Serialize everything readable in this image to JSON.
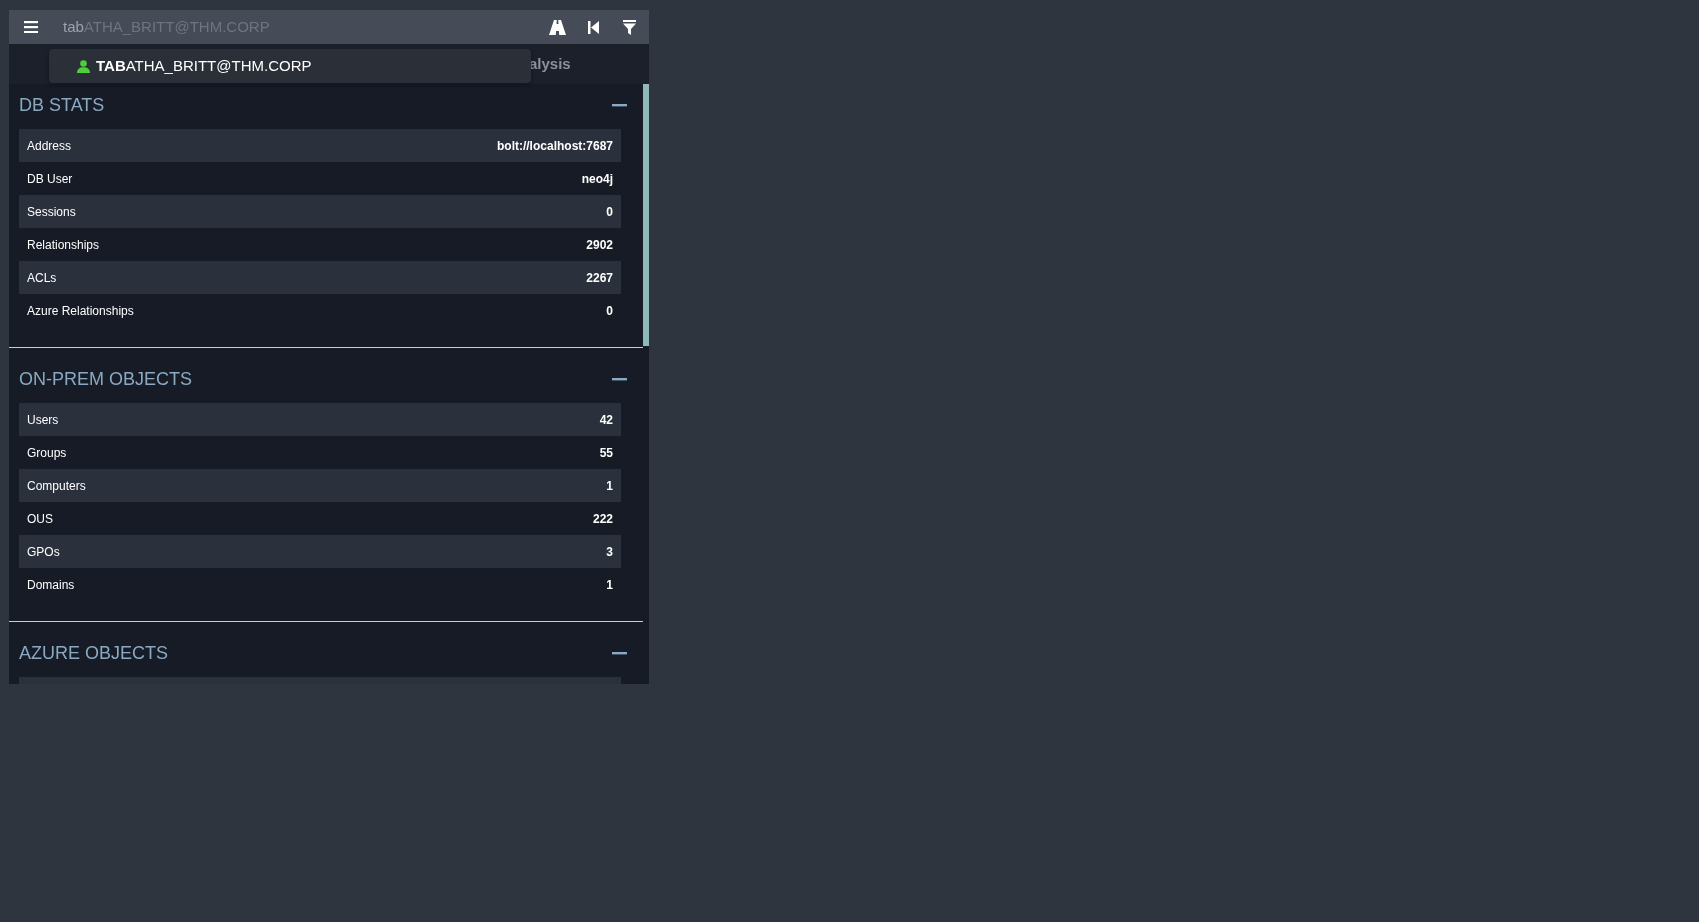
{
  "search": {
    "value": "tab",
    "completion": "ATHA_BRITT@THM.CORP"
  },
  "suggestions": [
    {
      "text": "**TAB**ATHA_BRITT@THM.CORP",
      "kind": "user"
    }
  ],
  "tabs": [
    {
      "label": "alysis"
    }
  ],
  "sections": [
    {
      "title": "DB STATS",
      "expanded": true,
      "rows": [
        {
          "label": "Address",
          "value": "bolt://localhost:7687"
        },
        {
          "label": "DB User",
          "value": "neo4j"
        },
        {
          "label": "Sessions",
          "value": "0"
        },
        {
          "label": "Relationships",
          "value": "2902"
        },
        {
          "label": "ACLs",
          "value": "2267"
        },
        {
          "label": "Azure Relationships",
          "value": "0"
        }
      ]
    },
    {
      "title": "ON-PREM OBJECTS",
      "expanded": true,
      "rows": [
        {
          "label": "Users",
          "value": "42"
        },
        {
          "label": "Groups",
          "value": "55"
        },
        {
          "label": "Computers",
          "value": "1"
        },
        {
          "label": "OUS",
          "value": "222"
        },
        {
          "label": "GPOs",
          "value": "3"
        },
        {
          "label": "Domains",
          "value": "1"
        }
      ]
    },
    {
      "title": "AZURE OBJECTS",
      "expanded": true
    }
  ]
}
